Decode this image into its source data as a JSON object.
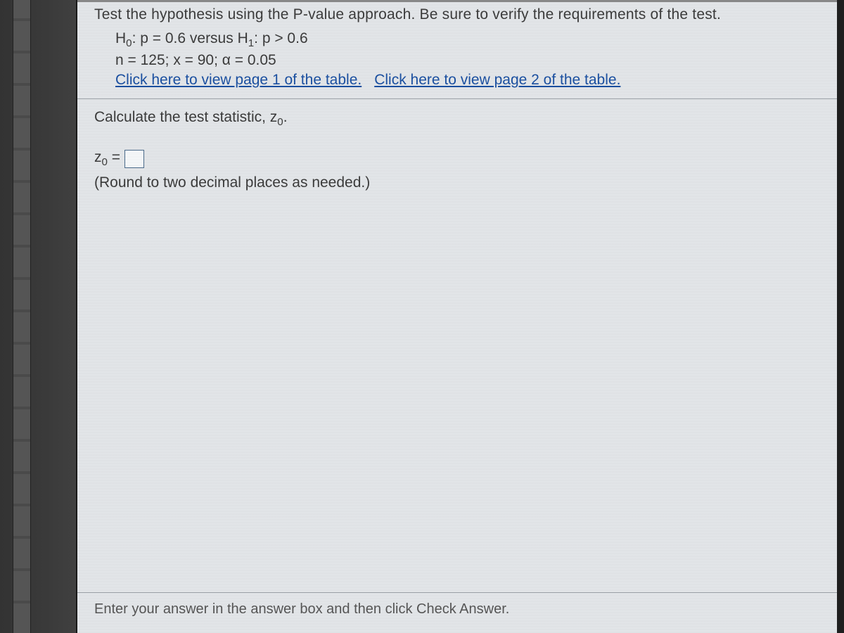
{
  "question": {
    "title": "Test the hypothesis using the P-value approach. Be sure to verify the requirements of the test.",
    "hypotheses": "H₀: p = 0.6 versus H₁: p > 0.6",
    "params": "n = 125; x = 90; α = 0.05",
    "link1": "Click here to view page 1 of the table.",
    "link2": "Click here to view page 2 of the table."
  },
  "task": {
    "instruction": "Calculate the test statistic, z₀.",
    "answer_label": "z₀ =",
    "answer_value": "",
    "round_note": "(Round to two decimal places as needed.)"
  },
  "footer": {
    "hint": "Enter your answer in the answer box and then click Check Answer."
  }
}
